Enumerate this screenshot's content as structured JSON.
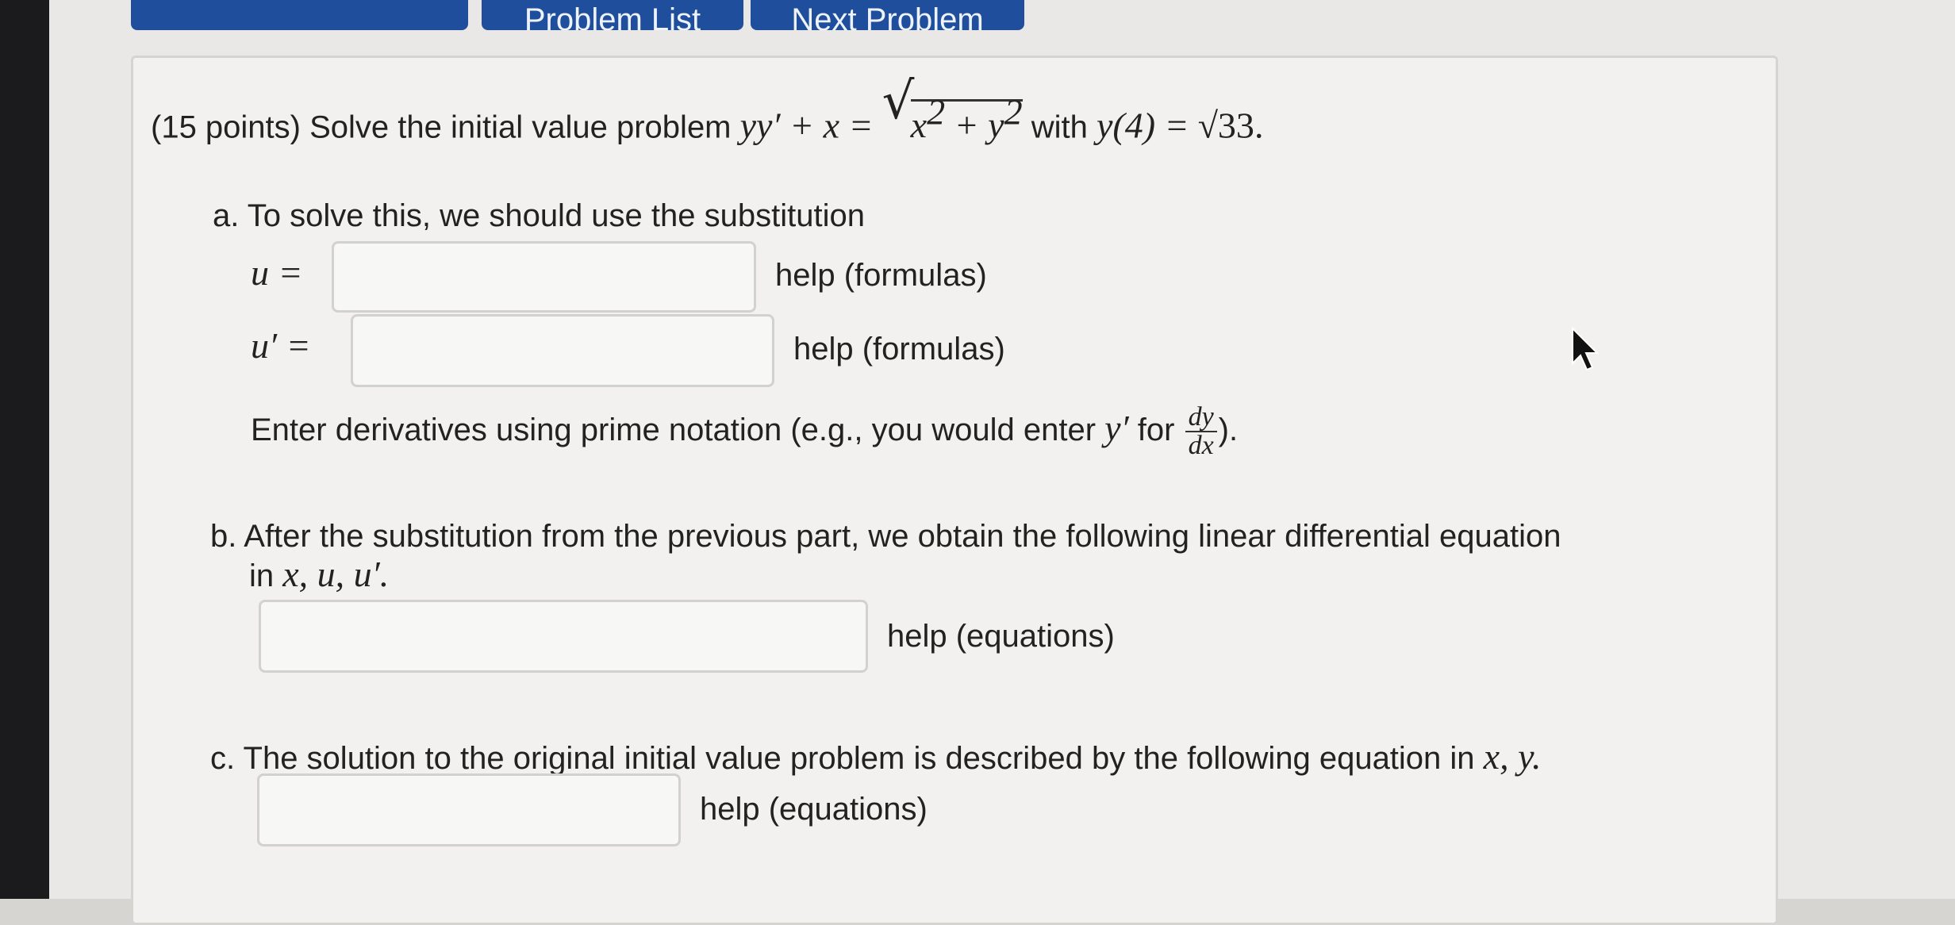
{
  "nav": {
    "buttons": [
      "Problem List",
      "Next Problem"
    ]
  },
  "problem": {
    "intro_prefix": "(15 points) Solve the initial value problem",
    "ode_lhs": "yy′ + x =",
    "ode_rhs_x": "x",
    "ode_rhs_y": "y",
    "exp": "2",
    "plus": "+",
    "with_text": "with",
    "initial_condition_lhs": "y(4) =",
    "initial_condition_rhs": "√33",
    "period": "."
  },
  "part_a": {
    "marker": "a.",
    "text": "To solve this, we should use the substitution",
    "u_label": "u =",
    "u_help": "help (formulas)",
    "uprime_label": "u′ =",
    "uprime_help": "help (formulas)",
    "note_prefix": "Enter derivatives using prime notation (e.g., you would enter",
    "note_yprime": "y′",
    "note_for": "for",
    "frac_num": "dy",
    "frac_den": "dx",
    "note_suffix": ")."
  },
  "part_b": {
    "marker": "b.",
    "text_line1": "After the substitution from the previous part, we obtain the following linear differential equation",
    "text_line2_prefix": "in",
    "text_line2_vars": "x, u, u′.",
    "help": "help (equations)"
  },
  "part_c": {
    "marker": "c.",
    "text_prefix": "The solution to the original initial value problem is described by the following equation in",
    "text_vars": "x, y.",
    "help": "help (equations)"
  }
}
